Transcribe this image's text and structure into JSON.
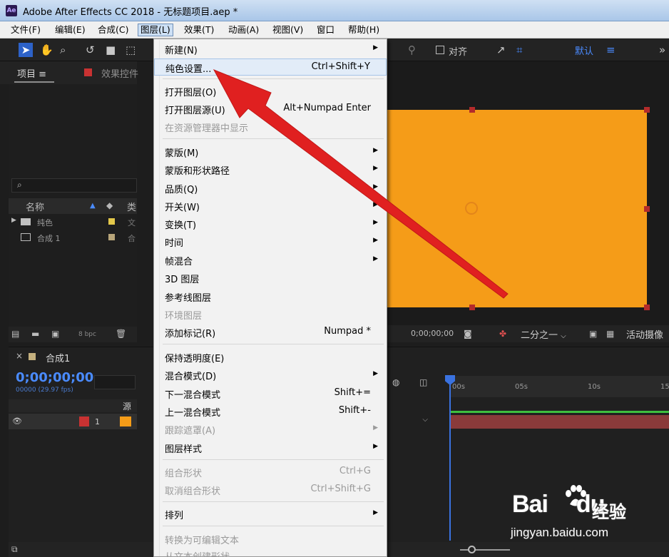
{
  "window": {
    "title": "Adobe After Effects CC 2018 - 无标题项目.aep *",
    "app_icon": "Ae"
  },
  "menubar": {
    "items": [
      {
        "label": "文件(F)"
      },
      {
        "label": "编辑(E)"
      },
      {
        "label": "合成(C)"
      },
      {
        "label": "图层(L)"
      },
      {
        "label": "效果(T)"
      },
      {
        "label": "动画(A)"
      },
      {
        "label": "视图(V)"
      },
      {
        "label": "窗口"
      },
      {
        "label": "帮助(H)"
      }
    ]
  },
  "toolbar": {
    "snap_label": "对齐",
    "workspace_label": "默认",
    "workspace_menu_icon": "≡",
    "overflow_icon": "»"
  },
  "project_panel": {
    "tab_label": "项目",
    "effects_tab_label": "效果控件",
    "menu_icon": "≡",
    "columns": {
      "name": "名称",
      "type": "类"
    },
    "items": [
      {
        "name": "纯色",
        "type": "文",
        "chip_color": "#e3c84a"
      },
      {
        "name": "合成 1",
        "type": "合",
        "chip_color": "#b8a57a"
      }
    ],
    "bpc": "8 bpc"
  },
  "viewer": {
    "layer_color": "#f59c18",
    "timecode": "0;00;00;00",
    "resolution": "二分之一",
    "camera": "活动摄像"
  },
  "timeline": {
    "tab_label": "合成1",
    "timecode": "0;00;00;00",
    "fps": "00000 (29.97 fps)",
    "source_col": "源",
    "layer_number": "1",
    "ticks": [
      "00s",
      "05s",
      "10s",
      "15"
    ]
  },
  "layer_menu": {
    "items": [
      {
        "label": "新建(N)",
        "shortcut": "",
        "submenu": true,
        "disabled": false
      },
      {
        "label": "纯色设置...",
        "shortcut": "Ctrl+Shift+Y",
        "submenu": false,
        "disabled": false,
        "highlighted": true
      },
      {
        "label": "打开图层(O)",
        "shortcut": "",
        "submenu": false,
        "disabled": false
      },
      {
        "label": "打开图层源(U)",
        "shortcut": "Alt+Numpad Enter",
        "submenu": false,
        "disabled": false
      },
      {
        "label": "在资源管理器中显示",
        "shortcut": "",
        "submenu": false,
        "disabled": true
      },
      {
        "label": "蒙版(M)",
        "shortcut": "",
        "submenu": true,
        "disabled": false
      },
      {
        "label": "蒙版和形状路径",
        "shortcut": "",
        "submenu": true,
        "disabled": false
      },
      {
        "label": "品质(Q)",
        "shortcut": "",
        "submenu": true,
        "disabled": false
      },
      {
        "label": "开关(W)",
        "shortcut": "",
        "submenu": true,
        "disabled": false
      },
      {
        "label": "变换(T)",
        "shortcut": "",
        "submenu": true,
        "disabled": false
      },
      {
        "label": "时间",
        "shortcut": "",
        "submenu": true,
        "disabled": false
      },
      {
        "label": "帧混合",
        "shortcut": "",
        "submenu": true,
        "disabled": false
      },
      {
        "label": "3D 图层",
        "shortcut": "",
        "submenu": false,
        "disabled": false
      },
      {
        "label": "参考线图层",
        "shortcut": "",
        "submenu": false,
        "disabled": false
      },
      {
        "label": "环境图层",
        "shortcut": "",
        "submenu": false,
        "disabled": true
      },
      {
        "label": "添加标记(R)",
        "shortcut": "Numpad *",
        "submenu": false,
        "disabled": false
      },
      {
        "label": "保持透明度(E)",
        "shortcut": "",
        "submenu": false,
        "disabled": false
      },
      {
        "label": "混合模式(D)",
        "shortcut": "",
        "submenu": true,
        "disabled": false
      },
      {
        "label": "下一混合模式",
        "shortcut": "Shift+=",
        "submenu": false,
        "disabled": false
      },
      {
        "label": "上一混合模式",
        "shortcut": "Shift+-",
        "submenu": false,
        "disabled": false
      },
      {
        "label": "跟踪遮罩(A)",
        "shortcut": "",
        "submenu": true,
        "disabled": true
      },
      {
        "label": "图层样式",
        "shortcut": "",
        "submenu": true,
        "disabled": false
      },
      {
        "label": "组合形状",
        "shortcut": "Ctrl+G",
        "submenu": false,
        "disabled": true
      },
      {
        "label": "取消组合形状",
        "shortcut": "Ctrl+Shift+G",
        "submenu": false,
        "disabled": true
      },
      {
        "label": "排列",
        "shortcut": "",
        "submenu": true,
        "disabled": false
      },
      {
        "label": "转换为可编辑文本",
        "shortcut": "",
        "submenu": false,
        "disabled": true
      },
      {
        "label": "从文本创建形状",
        "shortcut": "",
        "submenu": false,
        "disabled": true
      }
    ]
  },
  "watermark": {
    "logo": "Bai",
    "logo_suffix": "du",
    "brand": "经验",
    "url": "jingyan.baidu.com"
  },
  "annotation": {
    "arrow_color": "#e02020"
  }
}
